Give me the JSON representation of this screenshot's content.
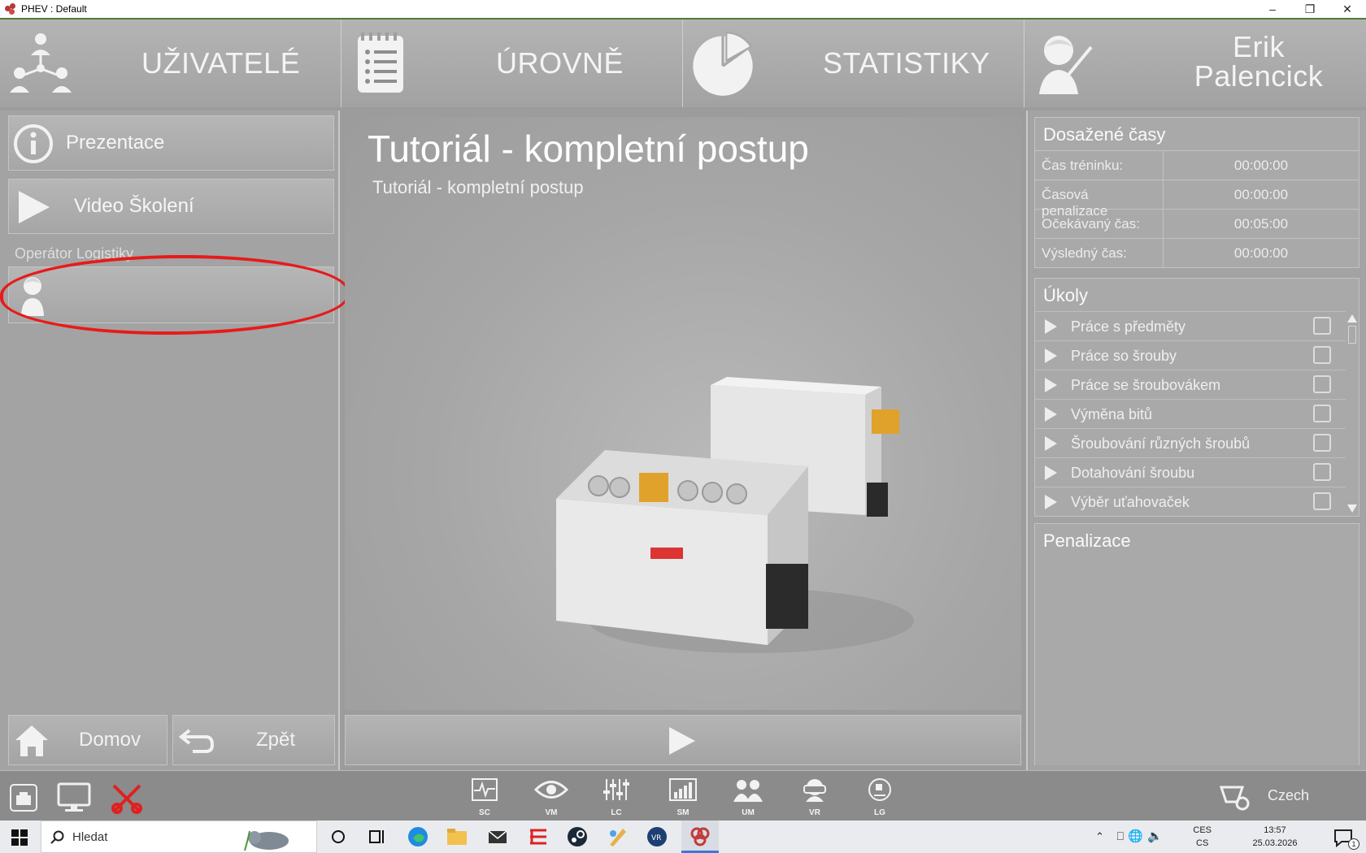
{
  "window": {
    "title": "PHEV : Default"
  },
  "nav": {
    "users": "UŽIVATELÉ",
    "levels": "ÚROVNĚ",
    "stats": "STATISTIKY",
    "user_first": "Erik",
    "user_last": "Palencick"
  },
  "left": {
    "presentation": "Prezentace",
    "video": "Video Školení",
    "section": "Operátor Logistiky",
    "home": "Domov",
    "back": "Zpět"
  },
  "center": {
    "title": "Tutoriál - kompletní postup",
    "subtitle": "Tutoriál - kompletní postup"
  },
  "times": {
    "header": "Dosažené časy",
    "rows": [
      {
        "label": "Čas tréninku:",
        "value": "00:00:00"
      },
      {
        "label": "Časová penalizace",
        "value": "00:00:00"
      },
      {
        "label": "Očekávaný čas:",
        "value": "00:05:00"
      },
      {
        "label": "Výsledný čas:",
        "value": "00:00:00"
      }
    ]
  },
  "tasks": {
    "header": "Úkoly",
    "items": [
      "Práce s předměty",
      "Práce so šrouby",
      "Práce se šroubovákem",
      "Výměna bitů",
      "Šroubování různých šroubů",
      "Dotahování šroubu",
      "Výběr uťahovaček"
    ]
  },
  "penalties": {
    "header": "Penalizace"
  },
  "statusbar": {
    "tools": [
      "SC",
      "VM",
      "LC",
      "SM",
      "UM",
      "VR",
      "LG"
    ],
    "language": "Czech"
  },
  "taskbar": {
    "search_placeholder": "Hledat",
    "lang_top": "CES",
    "lang_bottom": "CS",
    "time": "13:57",
    "date": "25.03.2026",
    "notifications": "1"
  }
}
